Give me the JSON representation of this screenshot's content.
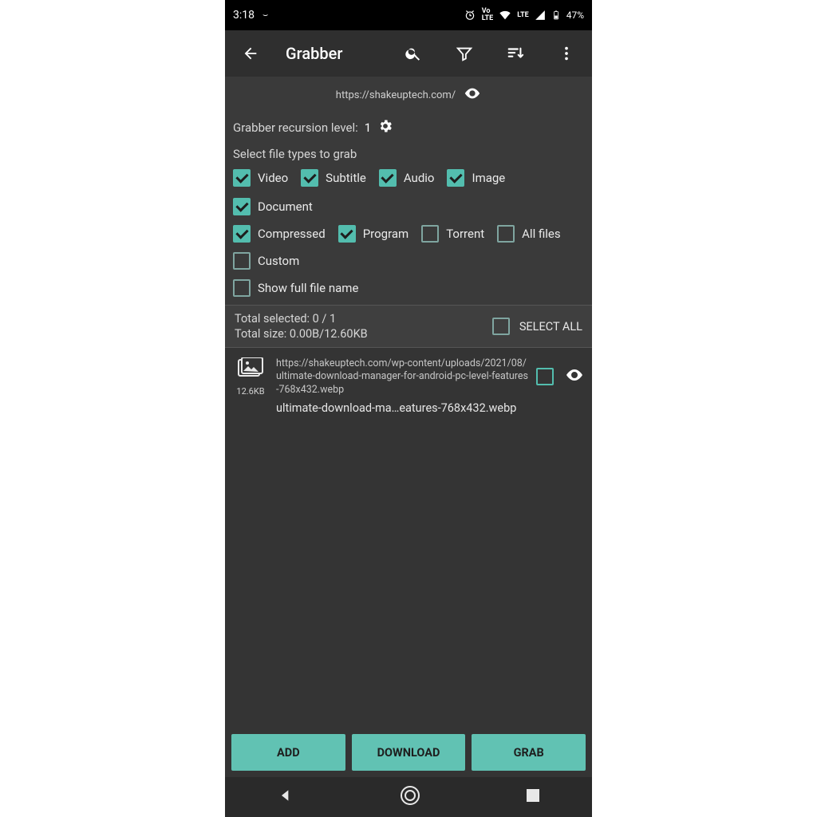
{
  "statusbar": {
    "time": "3:18",
    "lte": "LTE",
    "battery": "47%"
  },
  "appbar": {
    "title": "Grabber"
  },
  "url": "https://shakeuptech.com/",
  "recursion": {
    "label": "Grabber recursion level:",
    "value": "1"
  },
  "filetypes": {
    "heading": "Select file types to grab",
    "items": [
      {
        "label": "Video",
        "checked": true
      },
      {
        "label": "Subtitle",
        "checked": true
      },
      {
        "label": "Audio",
        "checked": true
      },
      {
        "label": "Image",
        "checked": true
      },
      {
        "label": "Document",
        "checked": true
      },
      {
        "label": "Compressed",
        "checked": true
      },
      {
        "label": "Program",
        "checked": true
      },
      {
        "label": "Torrent",
        "checked": false
      },
      {
        "label": "All files",
        "checked": false
      }
    ]
  },
  "options": {
    "custom": {
      "label": "Custom",
      "checked": false
    },
    "show_full": {
      "label": "Show full file name",
      "checked": false
    }
  },
  "summary": {
    "selected_label": "Total selected: 0 / 1",
    "size_label": "Total size: 0.00B/12.60KB",
    "select_all": "SELECT ALL",
    "select_all_checked": false
  },
  "files": [
    {
      "url": "https://shakeuptech.com/wp-content/uploads/2021/08/ultimate-download-manager-for-android-pc-level-features-768x432.webp",
      "name": "ultimate-download-ma…eatures-768x432.webp",
      "size": "12.6KB",
      "checked": false
    }
  ],
  "buttons": {
    "add": "ADD",
    "download": "DOWNLOAD",
    "grab": "GRAB"
  }
}
